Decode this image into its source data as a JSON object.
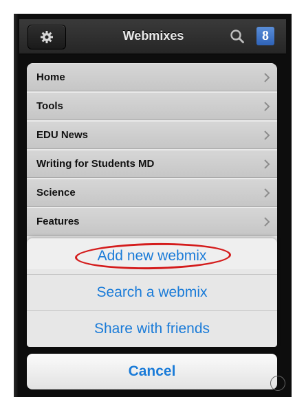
{
  "navbar": {
    "title": "Webmixes",
    "settings_icon": "gear-icon",
    "search_icon": "search-icon",
    "google_icon": "google-icon",
    "google_label": "8"
  },
  "list": {
    "items": [
      {
        "label": "Home"
      },
      {
        "label": "Tools"
      },
      {
        "label": "EDU News"
      },
      {
        "label": "Writing for Students MD"
      },
      {
        "label": "Science"
      },
      {
        "label": "Features"
      }
    ],
    "chevron_icon": "chevron-right-icon"
  },
  "action_sheet": {
    "items": [
      {
        "label": "Add new webmix",
        "highlighted": true
      },
      {
        "label": "Search a webmix"
      },
      {
        "label": "Share with friends"
      }
    ],
    "cancel_label": "Cancel",
    "accent_color": "#1a7bd8",
    "highlight_color": "#d41c1c"
  }
}
